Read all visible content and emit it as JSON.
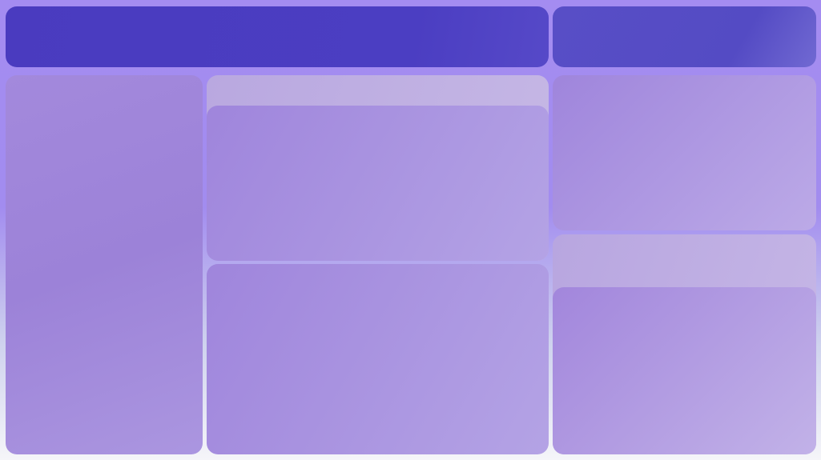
{
  "layout_regions": [
    "header-bar",
    "header-side-panel",
    "sidebar",
    "center-card-top",
    "center-card-bottom",
    "right-card-top",
    "right-card-bottom"
  ]
}
